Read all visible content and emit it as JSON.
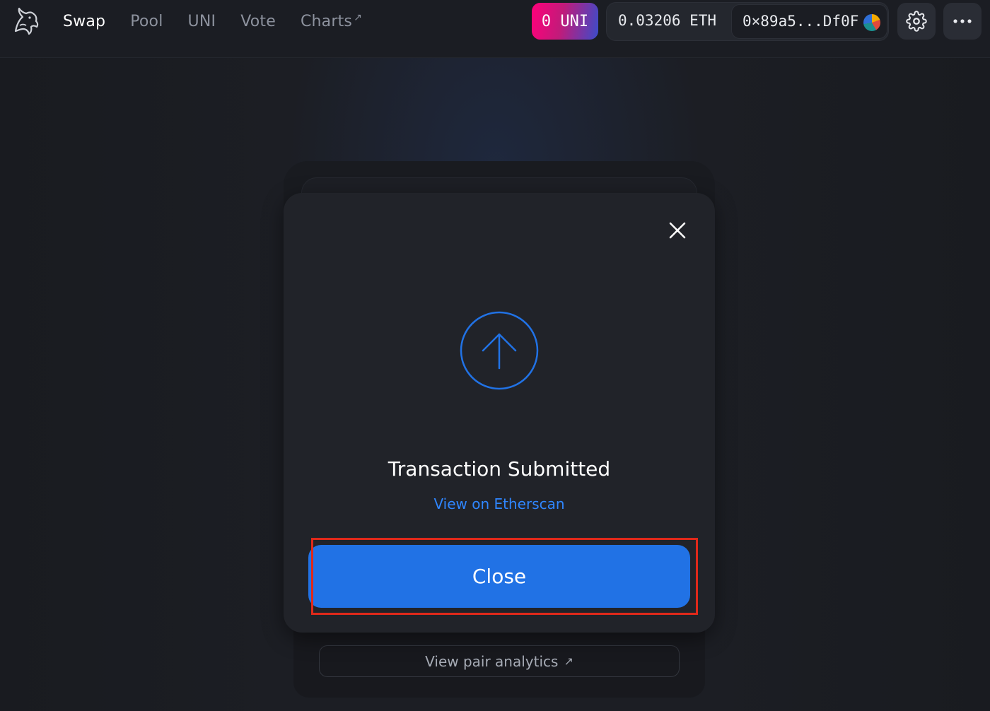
{
  "header": {
    "nav": [
      {
        "label": "Swap",
        "active": true
      },
      {
        "label": "Pool",
        "active": false
      },
      {
        "label": "UNI",
        "active": false
      },
      {
        "label": "Vote",
        "active": false
      },
      {
        "label": "Charts",
        "active": false,
        "external": "↗"
      }
    ],
    "uni_badge": "0 UNI",
    "eth_balance": "0.03206 ETH",
    "address": "0×89a5...Df0F",
    "icons": {
      "logo": "uniswap-unicorn-icon",
      "settings": "gear-icon",
      "more": "ellipsis-icon"
    }
  },
  "modal": {
    "title": "Transaction Submitted",
    "link": "View on Etherscan",
    "button": "Close",
    "icons": {
      "close": "close-icon",
      "status": "arrow-up-circle-icon"
    }
  },
  "background": {
    "analytics_label": "View pair analytics",
    "analytics_external": "↗"
  },
  "colors": {
    "accent": "#2172e5",
    "link": "#2f86ff",
    "highlight": "#e0291a",
    "uni_badge_gradient": [
      "#ff007a",
      "#3b4cca"
    ]
  }
}
